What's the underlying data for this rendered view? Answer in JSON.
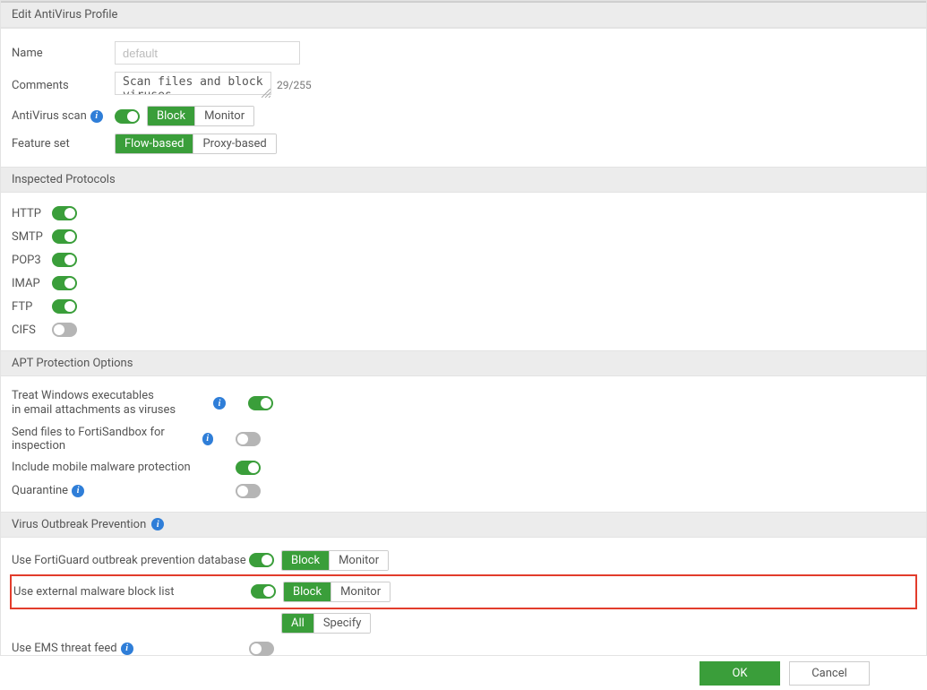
{
  "title": "Edit AntiVirus Profile",
  "general": {
    "name_label": "Name",
    "name_placeholder": "default",
    "comments_label": "Comments",
    "comments_value": "Scan files and block viruses.",
    "comments_counter": "29/255",
    "avscan_label": "AntiVirus scan",
    "avscan_opts": [
      "Block",
      "Monitor"
    ],
    "featureset_label": "Feature set",
    "featureset_opts": [
      "Flow-based",
      "Proxy-based"
    ]
  },
  "protocols": {
    "header": "Inspected Protocols",
    "items": [
      {
        "label": "HTTP",
        "on": true
      },
      {
        "label": "SMTP",
        "on": true
      },
      {
        "label": "POP3",
        "on": true
      },
      {
        "label": "IMAP",
        "on": true
      },
      {
        "label": "FTP",
        "on": true
      },
      {
        "label": "CIFS",
        "on": false
      }
    ]
  },
  "apt": {
    "header": "APT Protection Options",
    "treat_win_label": "Treat Windows executables\nin email attachments as viruses",
    "fortisandbox_label": "Send files to FortiSandbox for inspection",
    "mobile_label": "Include mobile malware protection",
    "quarantine_label": "Quarantine"
  },
  "vop": {
    "header": "Virus Outbreak Prevention",
    "fg_label": "Use FortiGuard outbreak prevention database",
    "fg_opts": [
      "Block",
      "Monitor"
    ],
    "ext_label": "Use external malware block list",
    "ext_opts": [
      "Block",
      "Monitor"
    ],
    "ext_sub_opts": [
      "All",
      "Specify"
    ],
    "ems_label": "Use EMS threat feed"
  },
  "footer": {
    "ok": "OK",
    "cancel": "Cancel"
  }
}
